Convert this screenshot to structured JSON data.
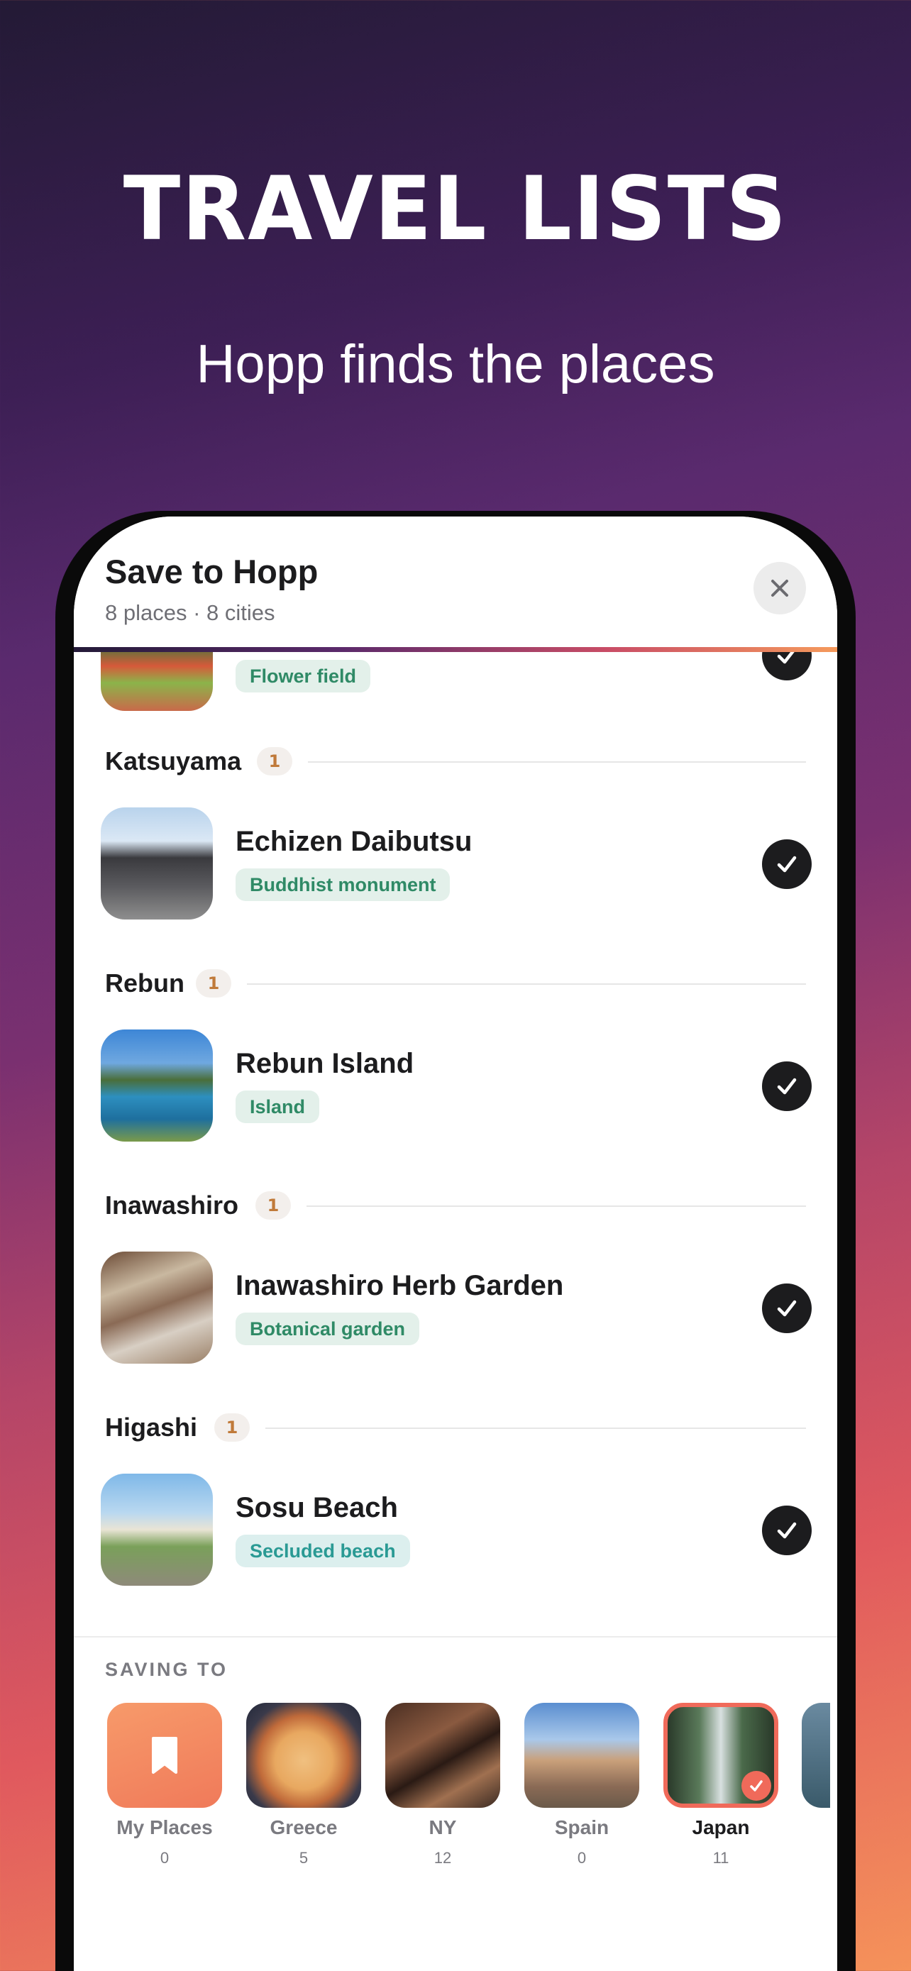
{
  "hero": {
    "headline": "TRAVEL LISTS",
    "subline": "Hopp finds the places"
  },
  "sheet": {
    "title": "Save to Hopp",
    "subtitle": "8 places · 8 cities"
  },
  "list": {
    "partial_place": {
      "tag": "Flower field"
    },
    "sections": [
      {
        "city": "Katsuyama",
        "count": "1",
        "place": {
          "name": "Echizen Daibutsu",
          "tag": "Buddhist monument"
        }
      },
      {
        "city": "Rebun",
        "count": "1",
        "place": {
          "name": "Rebun Island",
          "tag": "Island"
        }
      },
      {
        "city": "Inawashiro",
        "count": "1",
        "place": {
          "name": "Inawashiro Herb Garden",
          "tag": "Botanical garden"
        }
      },
      {
        "city": "Higashi",
        "count": "1",
        "place": {
          "name": "Sosu Beach",
          "tag": "Secluded beach"
        }
      }
    ]
  },
  "footer": {
    "heading": "SAVING TO",
    "lists": [
      {
        "name": "My Places",
        "count": "0"
      },
      {
        "name": "Greece",
        "count": "5"
      },
      {
        "name": "NY",
        "count": "12"
      },
      {
        "name": "Spain",
        "count": "0"
      },
      {
        "name": "Japan",
        "count": "11",
        "selected": true
      }
    ]
  },
  "colors": {
    "accent": "#f06a5a",
    "tag_bg": "#e3f0ea",
    "tag_text": "#2f8a66"
  }
}
